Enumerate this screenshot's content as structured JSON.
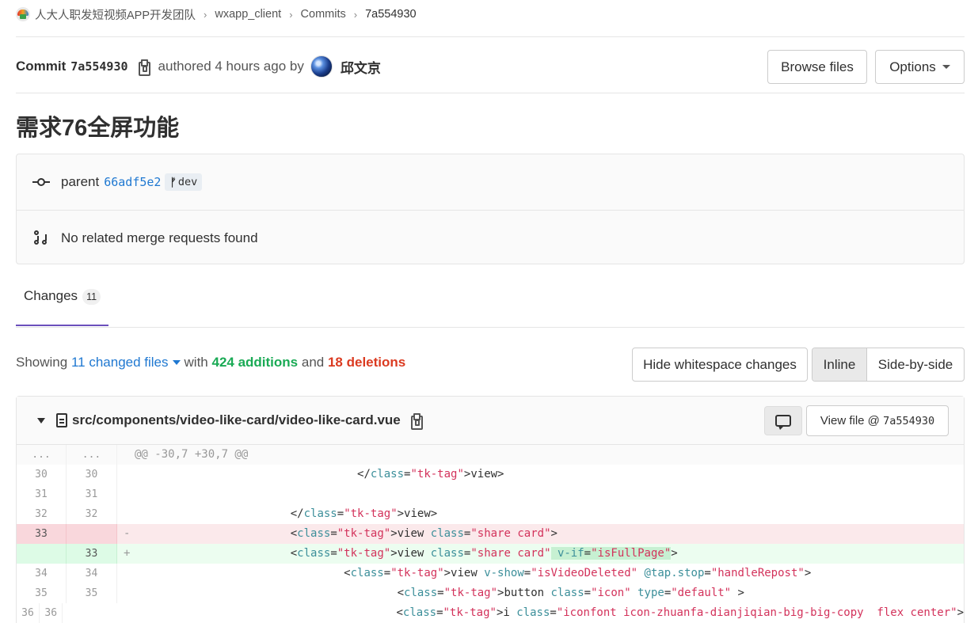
{
  "breadcrumb": {
    "group": "人大人职发短视频APP开发团队",
    "project": "wxapp_client",
    "section": "Commits",
    "current": "7a554930"
  },
  "commit": {
    "label": "Commit",
    "sha": "7a554930",
    "authored_text": "authored 4 hours ago by",
    "author": "邱文京",
    "title": "需求76全屏功能"
  },
  "buttons": {
    "browse_files": "Browse files",
    "options": "Options"
  },
  "info": {
    "parent_label": "parent",
    "parent_sha": "66adf5e2",
    "branch": "dev",
    "merge_requests": "No related merge requests found"
  },
  "tabs": {
    "changes_label": "Changes",
    "changes_count": "11"
  },
  "summary": {
    "showing": "Showing",
    "files_link": "11 changed files",
    "with": "with",
    "additions": "424 additions",
    "and": "and",
    "deletions": "18 deletions"
  },
  "diff_controls": {
    "hide_whitespace": "Hide whitespace changes",
    "inline": "Inline",
    "side_by_side": "Side-by-side",
    "active_view": "Inline"
  },
  "file": {
    "path": "src/components/video-like-card/video-like-card.vue",
    "view_file_label": "View file @",
    "view_file_sha": "7a554930"
  },
  "icons": {
    "logo": "group-logo-icon",
    "copy": "clipboard-icon",
    "commit": "commit-node-icon",
    "merge_request": "merge-request-icon",
    "branch": "branch-icon",
    "collapse": "chevron-down-icon",
    "file": "file-icon",
    "comment": "comment-icon"
  },
  "colors": {
    "link": "#1f78d1",
    "additions": "#1aaa55",
    "deletions": "#db3b21",
    "tab_underline": "#6b4fbb",
    "removed_line_bg": "#fbe9eb",
    "added_line_bg": "#ecfdf0"
  },
  "diff_lines": [
    {
      "type": "match",
      "old": "...",
      "new": "...",
      "prefix": "",
      "code": "@@ -30,7 +30,7 @@"
    },
    {
      "type": "context",
      "old": "30",
      "new": "30",
      "prefix": " ",
      "code": "                                  </view>"
    },
    {
      "type": "context",
      "old": "31",
      "new": "31",
      "prefix": " ",
      "code": ""
    },
    {
      "type": "context",
      "old": "32",
      "new": "32",
      "prefix": " ",
      "code": "                        </view>"
    },
    {
      "type": "old",
      "old": "33",
      "new": "",
      "prefix": "-",
      "code": "                        <view class=\"share card\">"
    },
    {
      "type": "new",
      "old": "",
      "new": "33",
      "prefix": "+",
      "code": "                        <view class=\"share card\" v-if=\"isFullPage\">"
    },
    {
      "type": "context",
      "old": "34",
      "new": "34",
      "prefix": " ",
      "code": "                                <view v-show=\"isVideoDeleted\" @tap.stop=\"handleRepost\">"
    },
    {
      "type": "context",
      "old": "35",
      "new": "35",
      "prefix": " ",
      "code": "                                        <button class=\"icon\" type=\"default\" >"
    },
    {
      "type": "context",
      "old": "36",
      "new": "36",
      "prefix": " ",
      "code": "                                                <i class=\"iconfont icon-zhuanfa-dianjiqian-big-big-copy  flex center\">"
    }
  ]
}
